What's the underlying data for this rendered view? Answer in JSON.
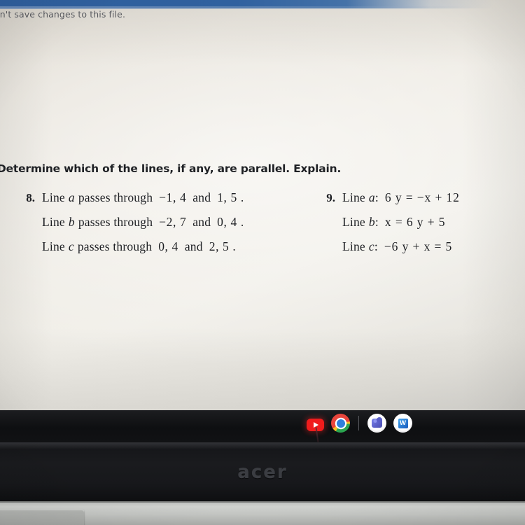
{
  "notification": {
    "message": "an't save changes to this file.",
    "bar_color": "#2e5e9c"
  },
  "worksheet": {
    "prompt": "Determine which of the lines, if any, are parallel. Explain.",
    "problems": [
      {
        "number": "8.",
        "lines": [
          {
            "label_prefix": "Line",
            "label_var": "a",
            "verb": "passes through",
            "point1": "−1, 4",
            "conj": "and",
            "point2": "1, 5",
            "period": "."
          },
          {
            "label_prefix": "Line",
            "label_var": "b",
            "verb": "passes through",
            "point1": "−2, 7",
            "conj": "and",
            "point2": "0, 4",
            "period": "."
          },
          {
            "label_prefix": "Line",
            "label_var": "c",
            "verb": "passes through",
            "point1": "0, 4",
            "conj": "and",
            "point2": "2, 5",
            "period": "."
          }
        ]
      },
      {
        "number": "9.",
        "lines": [
          {
            "label_prefix": "Line",
            "label_var": "a",
            "colon": ":",
            "equation": "6 y  =  −x + 12"
          },
          {
            "label_prefix": "Line",
            "label_var": "b",
            "colon": ":",
            "equation": "x  =  6 y + 5"
          },
          {
            "label_prefix": "Line",
            "label_var": "c",
            "colon": ":",
            "equation": "−6 y + x  =  5"
          }
        ]
      }
    ]
  },
  "taskbar": {
    "icons": [
      {
        "name": "youtube-icon",
        "label": "YouTube",
        "color": "#f01c1c"
      },
      {
        "name": "chrome-icon",
        "label": "Google Chrome",
        "color": "#2f7fdc"
      },
      {
        "name": "teams-icon",
        "label": "Microsoft Teams",
        "color": "#5b5fc7"
      },
      {
        "name": "word-icon",
        "label": "Microsoft Word",
        "color": "#185abd"
      }
    ]
  },
  "device": {
    "brand": "acer"
  }
}
